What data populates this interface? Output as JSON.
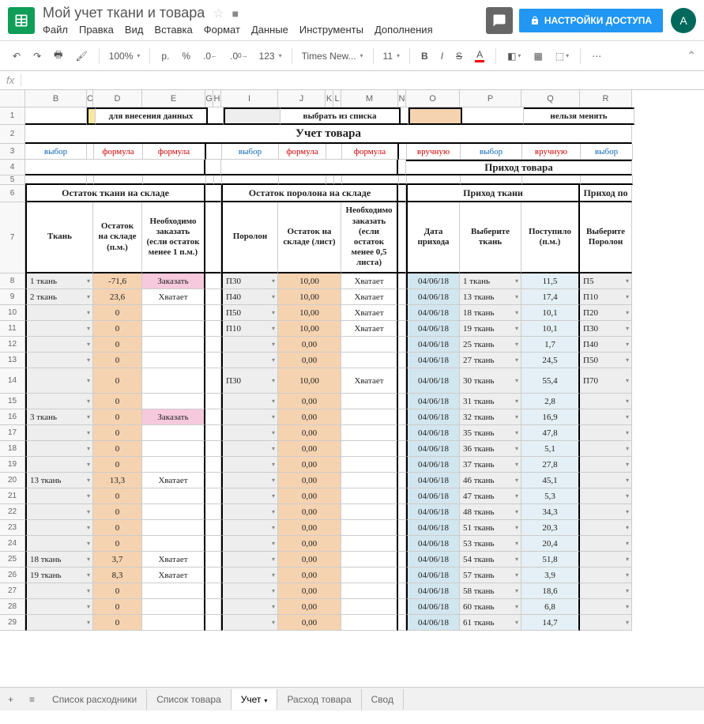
{
  "header": {
    "title": "Мой учет ткани и товара",
    "menus": [
      "Файл",
      "Правка",
      "Вид",
      "Вставка",
      "Формат",
      "Данные",
      "Инструменты",
      "Дополнения"
    ],
    "share": "НАСТРОЙКИ ДОСТУПА",
    "avatar": "А"
  },
  "toolbar": {
    "zoom": "100%",
    "currency": "р.",
    "pct": "%",
    "dec_dn": ".0",
    "dec_up": ".00",
    "more_fmt": "123",
    "font": "Times New...",
    "font_size": "11",
    "bold": "B",
    "italic": "I",
    "strike": "S",
    "text_color": "A"
  },
  "formula": "",
  "columns": [
    "B",
    "C",
    "D",
    "E",
    "G",
    "H",
    "I",
    "J",
    "K",
    "L",
    "M",
    "N",
    "O",
    "P",
    "Q",
    "R"
  ],
  "col_widths": {
    "B": 78,
    "C": 8,
    "D": 62,
    "E": 80,
    "G": 10,
    "H": 10,
    "I": 72,
    "J": 60,
    "K": 10,
    "L": 10,
    "M": 72,
    "N": 10,
    "O": 68,
    "P": 78,
    "Q": 74,
    "R": 66
  },
  "legend": {
    "a": "для внесения данных",
    "b": "выбрать из списка",
    "c": "нельзя менять"
  },
  "title_row": "Учет товара",
  "labels_row": [
    {
      "t": "выбор",
      "cls": "lbl-blue"
    },
    {
      "t": "формула",
      "cls": "lbl-red"
    },
    {
      "t": "формула",
      "cls": "lbl-red"
    },
    {
      "t": "выбор",
      "cls": "lbl-blue"
    },
    {
      "t": "формула",
      "cls": "lbl-red"
    },
    {
      "t": "формула",
      "cls": "lbl-red"
    },
    {
      "t": "вручную",
      "cls": "lbl-red"
    },
    {
      "t": "выбор",
      "cls": "lbl-blue"
    },
    {
      "t": "вручную",
      "cls": "lbl-red"
    },
    {
      "t": "выбор",
      "cls": "lbl-blue"
    }
  ],
  "section4": "Приход товара",
  "group_headers": [
    "Остаток ткани на складе",
    "Остаток поролона на складе",
    "Приход ткани",
    "Приход по"
  ],
  "col_headers7": [
    "Ткань",
    "Остаток на складе (п.м.)",
    "Необходимо заказать (если остаток менее 1 п.м.)",
    "Поролон",
    "Остаток на складе (лист)",
    "Необходимо заказать (если остаток менее 0,5 листа)",
    "Дата прихода",
    "Выберите ткань",
    "Поступило (п.м.)",
    "Выберите Поролон"
  ],
  "data_rows": [
    {
      "rn": 8,
      "fab": "1 ткань",
      "stock": "-71,6",
      "need": "Заказать",
      "needCls": "bg-pink",
      "por": "П30",
      "pstock": "10,00",
      "pneed": "Хватает",
      "date": "04/06/18",
      "pfab": "1 ткань",
      "amt": "11,5",
      "ppor": "П5"
    },
    {
      "rn": 9,
      "fab": "2 ткань",
      "stock": "23,6",
      "need": "Хватает",
      "needCls": "",
      "por": "П40",
      "pstock": "10,00",
      "pneed": "Хватает",
      "date": "04/06/18",
      "pfab": "13 ткань",
      "amt": "17,4",
      "ppor": "П10"
    },
    {
      "rn": 10,
      "fab": "",
      "stock": "0",
      "need": "",
      "needCls": "",
      "por": "П50",
      "pstock": "10,00",
      "pneed": "Хватает",
      "date": "04/06/18",
      "pfab": "18 ткань",
      "amt": "10,1",
      "ppor": "П20"
    },
    {
      "rn": 11,
      "fab": "",
      "stock": "0",
      "need": "",
      "needCls": "",
      "por": "П10",
      "pstock": "10,00",
      "pneed": "Хватает",
      "date": "04/06/18",
      "pfab": "19 ткань",
      "amt": "10,1",
      "ppor": "П30"
    },
    {
      "rn": 12,
      "fab": "",
      "stock": "0",
      "need": "",
      "needCls": "",
      "por": "",
      "pstock": "0,00",
      "pneed": "",
      "date": "04/06/18",
      "pfab": "25 ткань",
      "amt": "1,7",
      "ppor": "П40"
    },
    {
      "rn": 13,
      "fab": "",
      "stock": "0",
      "need": "",
      "needCls": "",
      "por": "",
      "pstock": "0,00",
      "pneed": "",
      "date": "04/06/18",
      "pfab": "27 ткань",
      "amt": "24,5",
      "ppor": "П50"
    },
    {
      "rn": 14,
      "tall": true,
      "fab": "",
      "stock": "0",
      "need": "",
      "needCls": "",
      "por": "П30",
      "pstock": "10,00",
      "pneed": "Хватает",
      "date": "04/06/18",
      "pfab": "30 ткань",
      "amt": "55,4",
      "ppor": "П70"
    },
    {
      "rn": 15,
      "fab": "",
      "stock": "0",
      "need": "",
      "needCls": "",
      "por": "",
      "pstock": "0,00",
      "pneed": "",
      "date": "04/06/18",
      "pfab": "31 ткань",
      "amt": "2,8",
      "ppor": ""
    },
    {
      "rn": 16,
      "fab": "3 ткань",
      "stock": "0",
      "need": "Заказать",
      "needCls": "bg-pink",
      "por": "",
      "pstock": "0,00",
      "pneed": "",
      "date": "04/06/18",
      "pfab": "32 ткань",
      "amt": "16,9",
      "ppor": ""
    },
    {
      "rn": 17,
      "fab": "",
      "stock": "0",
      "need": "",
      "needCls": "",
      "por": "",
      "pstock": "0,00",
      "pneed": "",
      "date": "04/06/18",
      "pfab": "35 ткань",
      "amt": "47,8",
      "ppor": ""
    },
    {
      "rn": 18,
      "fab": "",
      "stock": "0",
      "need": "",
      "needCls": "",
      "por": "",
      "pstock": "0,00",
      "pneed": "",
      "date": "04/06/18",
      "pfab": "36 ткань",
      "amt": "5,1",
      "ppor": ""
    },
    {
      "rn": 19,
      "fab": "",
      "stock": "0",
      "need": "",
      "needCls": "",
      "por": "",
      "pstock": "0,00",
      "pneed": "",
      "date": "04/06/18",
      "pfab": "37 ткань",
      "amt": "27,8",
      "ppor": ""
    },
    {
      "rn": 20,
      "fab": "13 ткань",
      "stock": "13,3",
      "need": "Хватает",
      "needCls": "",
      "por": "",
      "pstock": "0,00",
      "pneed": "",
      "date": "04/06/18",
      "pfab": "46 ткань",
      "amt": "45,1",
      "ppor": ""
    },
    {
      "rn": 21,
      "fab": "",
      "stock": "0",
      "need": "",
      "needCls": "",
      "por": "",
      "pstock": "0,00",
      "pneed": "",
      "date": "04/06/18",
      "pfab": "47 ткань",
      "amt": "5,3",
      "ppor": ""
    },
    {
      "rn": 22,
      "fab": "",
      "stock": "0",
      "need": "",
      "needCls": "",
      "por": "",
      "pstock": "0,00",
      "pneed": "",
      "date": "04/06/18",
      "pfab": "48 ткань",
      "amt": "34,3",
      "ppor": ""
    },
    {
      "rn": 23,
      "fab": "",
      "stock": "0",
      "need": "",
      "needCls": "",
      "por": "",
      "pstock": "0,00",
      "pneed": "",
      "date": "04/06/18",
      "pfab": "51 ткань",
      "amt": "20,3",
      "ppor": ""
    },
    {
      "rn": 24,
      "fab": "",
      "stock": "0",
      "need": "",
      "needCls": "",
      "por": "",
      "pstock": "0,00",
      "pneed": "",
      "date": "04/06/18",
      "pfab": "53 ткань",
      "amt": "20,4",
      "ppor": ""
    },
    {
      "rn": 25,
      "fab": "18 ткань",
      "stock": "3,7",
      "need": "Хватает",
      "needCls": "",
      "por": "",
      "pstock": "0,00",
      "pneed": "",
      "date": "04/06/18",
      "pfab": "54 ткань",
      "amt": "51,8",
      "ppor": ""
    },
    {
      "rn": 26,
      "fab": "19 ткань",
      "stock": "8,3",
      "need": "Хватает",
      "needCls": "",
      "por": "",
      "pstock": "0,00",
      "pneed": "",
      "date": "04/06/18",
      "pfab": "57 ткань",
      "amt": "3,9",
      "ppor": ""
    },
    {
      "rn": 27,
      "fab": "",
      "stock": "0",
      "need": "",
      "needCls": "",
      "por": "",
      "pstock": "0,00",
      "pneed": "",
      "date": "04/06/18",
      "pfab": "58 ткань",
      "amt": "18,6",
      "ppor": ""
    },
    {
      "rn": 28,
      "fab": "",
      "stock": "0",
      "need": "",
      "needCls": "",
      "por": "",
      "pstock": "0,00",
      "pneed": "",
      "date": "04/06/18",
      "pfab": "60 ткань",
      "amt": "6,8",
      "ppor": ""
    },
    {
      "rn": 29,
      "fab": "",
      "stock": "0",
      "need": "",
      "needCls": "",
      "por": "",
      "pstock": "0,00",
      "pneed": "",
      "date": "04/06/18",
      "pfab": "61 ткань",
      "amt": "14,7",
      "ppor": ""
    }
  ],
  "tabs": [
    "Список расходники",
    "Список товара",
    "Учет",
    "Расход товара",
    "Свод"
  ],
  "active_tab": 2
}
